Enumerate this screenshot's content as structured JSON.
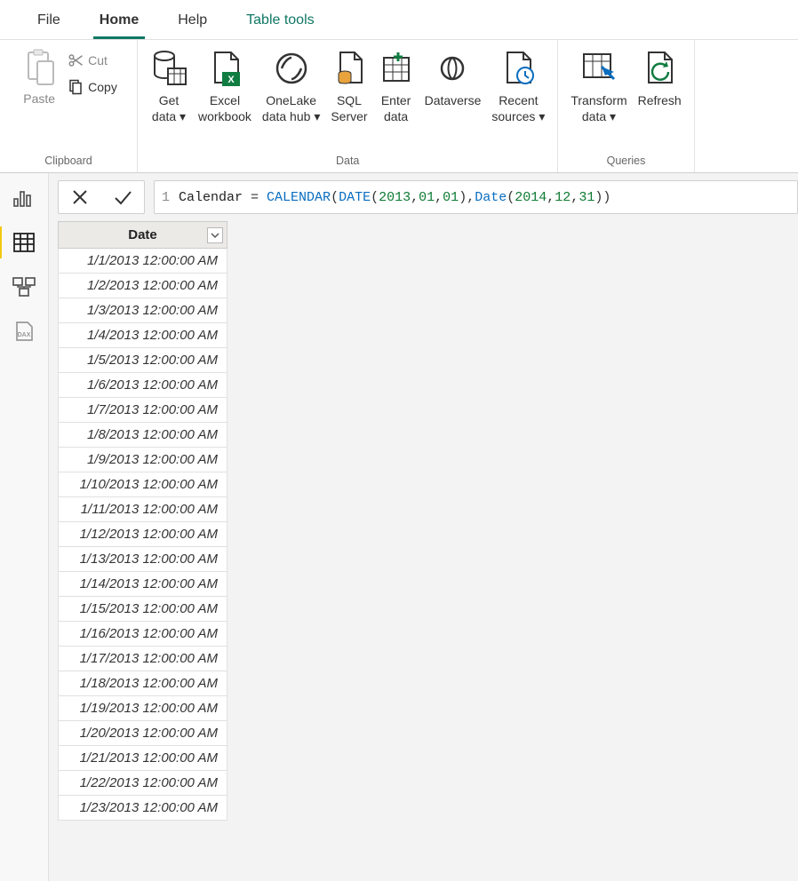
{
  "tabs": {
    "file": "File",
    "home": "Home",
    "help": "Help",
    "table_tools": "Table tools"
  },
  "ribbon": {
    "clipboard": {
      "label": "Clipboard",
      "paste": "Paste",
      "cut": "Cut",
      "copy": "Copy"
    },
    "data": {
      "label": "Data",
      "get_data": "Get\ndata",
      "excel": "Excel\nworkbook",
      "onelake": "OneLake\ndata hub",
      "sql": "SQL\nServer",
      "enter": "Enter\ndata",
      "dataverse": "Dataverse",
      "recent": "Recent\nsources"
    },
    "queries": {
      "label": "Queries",
      "transform": "Transform\ndata",
      "refresh": "Refresh"
    }
  },
  "formula": {
    "line_no": "1",
    "tokens": {
      "a": "Calendar ",
      "b": "= ",
      "c": "CALENDAR",
      "d": "(",
      "e": "DATE",
      "f": "(",
      "g": "2013",
      "h": ",",
      "i": "01",
      "j": ",",
      "k": "01",
      "l": ")",
      "m": ",",
      "n": "Date",
      "o": "(",
      "p": "2014",
      "q": ",",
      "r": "12",
      "s": ",",
      "t": "31",
      "u": ")",
      "v": ")"
    }
  },
  "table": {
    "header": "Date",
    "rows": [
      "1/1/2013 12:00:00 AM",
      "1/2/2013 12:00:00 AM",
      "1/3/2013 12:00:00 AM",
      "1/4/2013 12:00:00 AM",
      "1/5/2013 12:00:00 AM",
      "1/6/2013 12:00:00 AM",
      "1/7/2013 12:00:00 AM",
      "1/8/2013 12:00:00 AM",
      "1/9/2013 12:00:00 AM",
      "1/10/2013 12:00:00 AM",
      "1/11/2013 12:00:00 AM",
      "1/12/2013 12:00:00 AM",
      "1/13/2013 12:00:00 AM",
      "1/14/2013 12:00:00 AM",
      "1/15/2013 12:00:00 AM",
      "1/16/2013 12:00:00 AM",
      "1/17/2013 12:00:00 AM",
      "1/18/2013 12:00:00 AM",
      "1/19/2013 12:00:00 AM",
      "1/20/2013 12:00:00 AM",
      "1/21/2013 12:00:00 AM",
      "1/22/2013 12:00:00 AM",
      "1/23/2013 12:00:00 AM"
    ]
  }
}
